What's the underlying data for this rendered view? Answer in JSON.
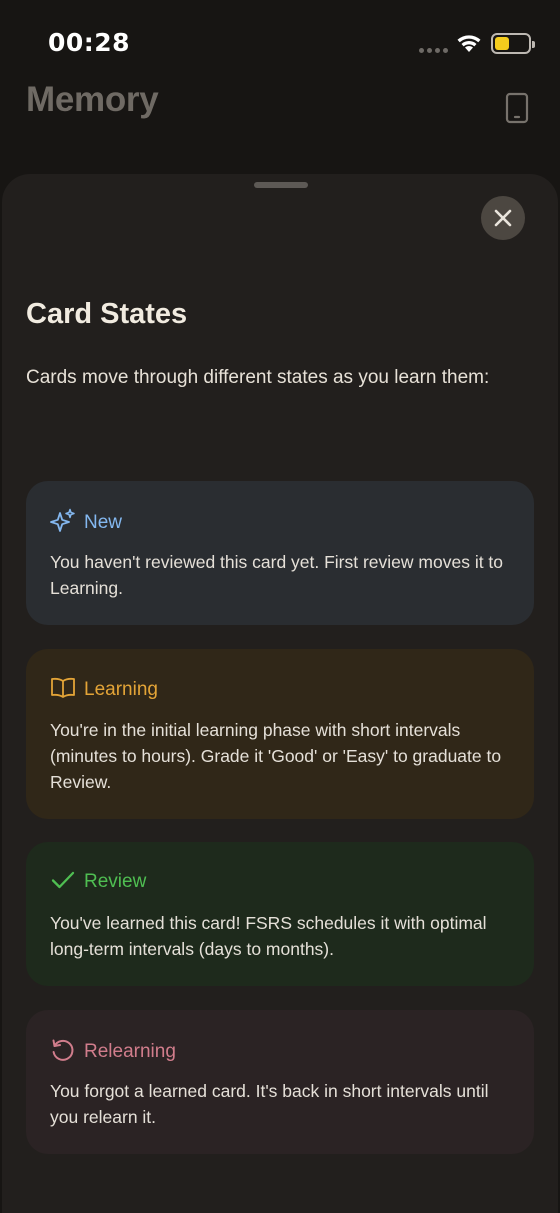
{
  "status_bar": {
    "time": "00:28"
  },
  "app": {
    "title": "Memory"
  },
  "sheet": {
    "title": "Card States",
    "intro": "Cards move through different states as you learn them:",
    "states": [
      {
        "label": "New",
        "icon": "sparkles-icon",
        "color": "#84b8f0",
        "description": "You haven't reviewed this card yet. First review moves it to Learning."
      },
      {
        "label": "Learning",
        "icon": "book-icon",
        "color": "#e3a437",
        "description": "You're in the initial learning phase with short intervals (minutes to hours). Grade it 'Good' or 'Easy' to graduate to Review."
      },
      {
        "label": "Review",
        "icon": "checkmark-icon",
        "color": "#4fbe52",
        "description": "You've learned this card! FSRS schedules it with optimal long-term intervals (days to months)."
      },
      {
        "label": "Relearning",
        "icon": "rotate-ccw-icon",
        "color": "#d17d8c",
        "description": "You forgot a learned card. It's back in short intervals until you relearn it."
      }
    ]
  }
}
